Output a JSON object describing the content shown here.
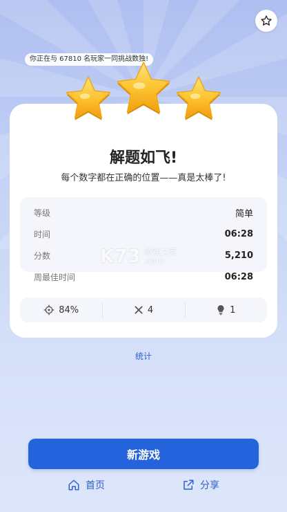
{
  "header": {
    "favorite_icon": "star-outline-icon"
  },
  "badge": {
    "text": "你正在与 67810 名玩家一同挑战数独!"
  },
  "result": {
    "stars_earned": 3,
    "title": "解题如飞!",
    "subtitle": "每个数字都在正确的位置——真是太棒了!"
  },
  "stats": [
    {
      "label": "等级",
      "value": "简单"
    },
    {
      "label": "时间",
      "value": "06:28"
    },
    {
      "label": "分数",
      "value": "5,210"
    },
    {
      "label": "周最佳时间",
      "value": "06:28"
    }
  ],
  "metrics": {
    "accuracy": {
      "icon": "target-icon",
      "value": "84%"
    },
    "mistakes": {
      "icon": "cross-icon",
      "value": "4"
    },
    "hints": {
      "icon": "lightbulb-icon",
      "value": "1"
    }
  },
  "watermark": {
    "main": "K73",
    "line1": "游戏之家",
    "line2": ".com"
  },
  "links": {
    "stats": "统计"
  },
  "actions": {
    "new_game": "新游戏",
    "home": "首页",
    "share": "分享"
  },
  "colors": {
    "accent": "#2563dc",
    "link": "#2f5fd0",
    "star": "#f7b924",
    "background_top": "#aebef0"
  }
}
